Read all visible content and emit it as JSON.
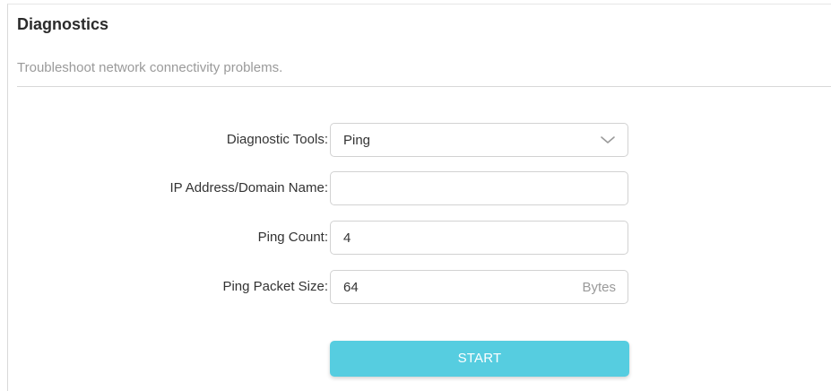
{
  "header": {
    "title": "Diagnostics",
    "subtitle": "Troubleshoot network connectivity problems."
  },
  "form": {
    "tool": {
      "label": "Diagnostic Tools:",
      "value": "Ping",
      "icon": "chevron-down-icon"
    },
    "address": {
      "label": "IP Address/Domain Name:",
      "value": ""
    },
    "count": {
      "label": "Ping Count:",
      "value": "4"
    },
    "packet_size": {
      "label": "Ping Packet Size:",
      "value": "64",
      "unit": "Bytes"
    }
  },
  "actions": {
    "start_label": "START"
  },
  "colors": {
    "accent": "#56cde0",
    "label": "#333333",
    "muted": "#9a9a9a",
    "border": "#d2d2d2"
  }
}
